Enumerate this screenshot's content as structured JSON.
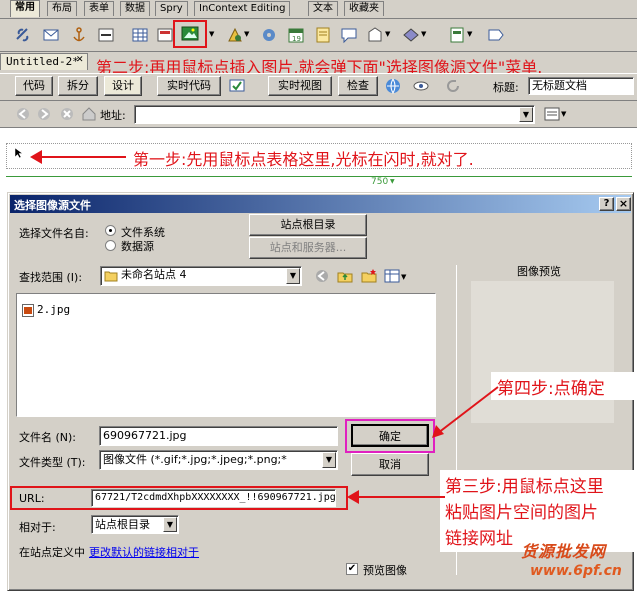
{
  "insert_bar": {
    "tabs": [
      "常用",
      "布局",
      "表单",
      "数据",
      "Spry",
      "InContext Editing",
      "文本",
      "收藏夹"
    ]
  },
  "document": {
    "tab_title": "Untitled-2*",
    "views": [
      "代码",
      "拆分",
      "设计"
    ],
    "live_code": "实时代码",
    "live_view": "实时视图",
    "inspect": "检查",
    "title_label": "标题:",
    "title_value": "无标题文档",
    "address_label": "地址:",
    "width_indicator": "750"
  },
  "annotations": {
    "step1": "第一步:先用鼠标点表格这里,光标在闪时,就对了.",
    "step2": "第二步:再用鼠标点插入图片,就会弹下面\"选择图像源文件\"菜单.",
    "step3_line1": "第三步:用鼠标点这里",
    "step3_line2": "粘贴图片空间的图片",
    "step3_line3": "链接网址",
    "step4": "第四步:点确定"
  },
  "dialog": {
    "title": "选择图像源文件",
    "help": "?",
    "close": "×",
    "select_from_label": "选择文件名自:",
    "radio_filesystem": "文件系统",
    "radio_datasource": "数据源",
    "site_root_button": "站点根目录",
    "site_server_button": "站点和服务器...",
    "look_in_label": "查找范围 (I):",
    "look_in_value": "未命名站点 4",
    "preview_label": "图像预览",
    "file_item": "2.jpg",
    "filename_label": "文件名 (N):",
    "filename_value": "690967721.jpg",
    "filetype_label": "文件类型 (T):",
    "filetype_value": "图像文件 (*.gif;*.jpg;*.jpeg;*.png;*",
    "ok_button": "确定",
    "cancel_button": "取消",
    "url_label": "URL:",
    "url_value": "67721/T2cdmdXhpbXXXXXXXX_!!690967721.jpg",
    "relative_label": "相对于:",
    "relative_value": "站点根目录",
    "site_def_prefix": "在站点定义中",
    "site_def_link": "更改默认的链接相对于",
    "preview_checkbox": "预览图像"
  },
  "watermark": {
    "line1": "货源批发网",
    "line2": "www.6pf.cn"
  },
  "colors": {
    "annotation": "#e0141a",
    "highlight_box": "#e020c0",
    "dialog_title_start": "#0a246a",
    "dialog_title_end": "#a6caf0",
    "link": "#0000ee"
  }
}
